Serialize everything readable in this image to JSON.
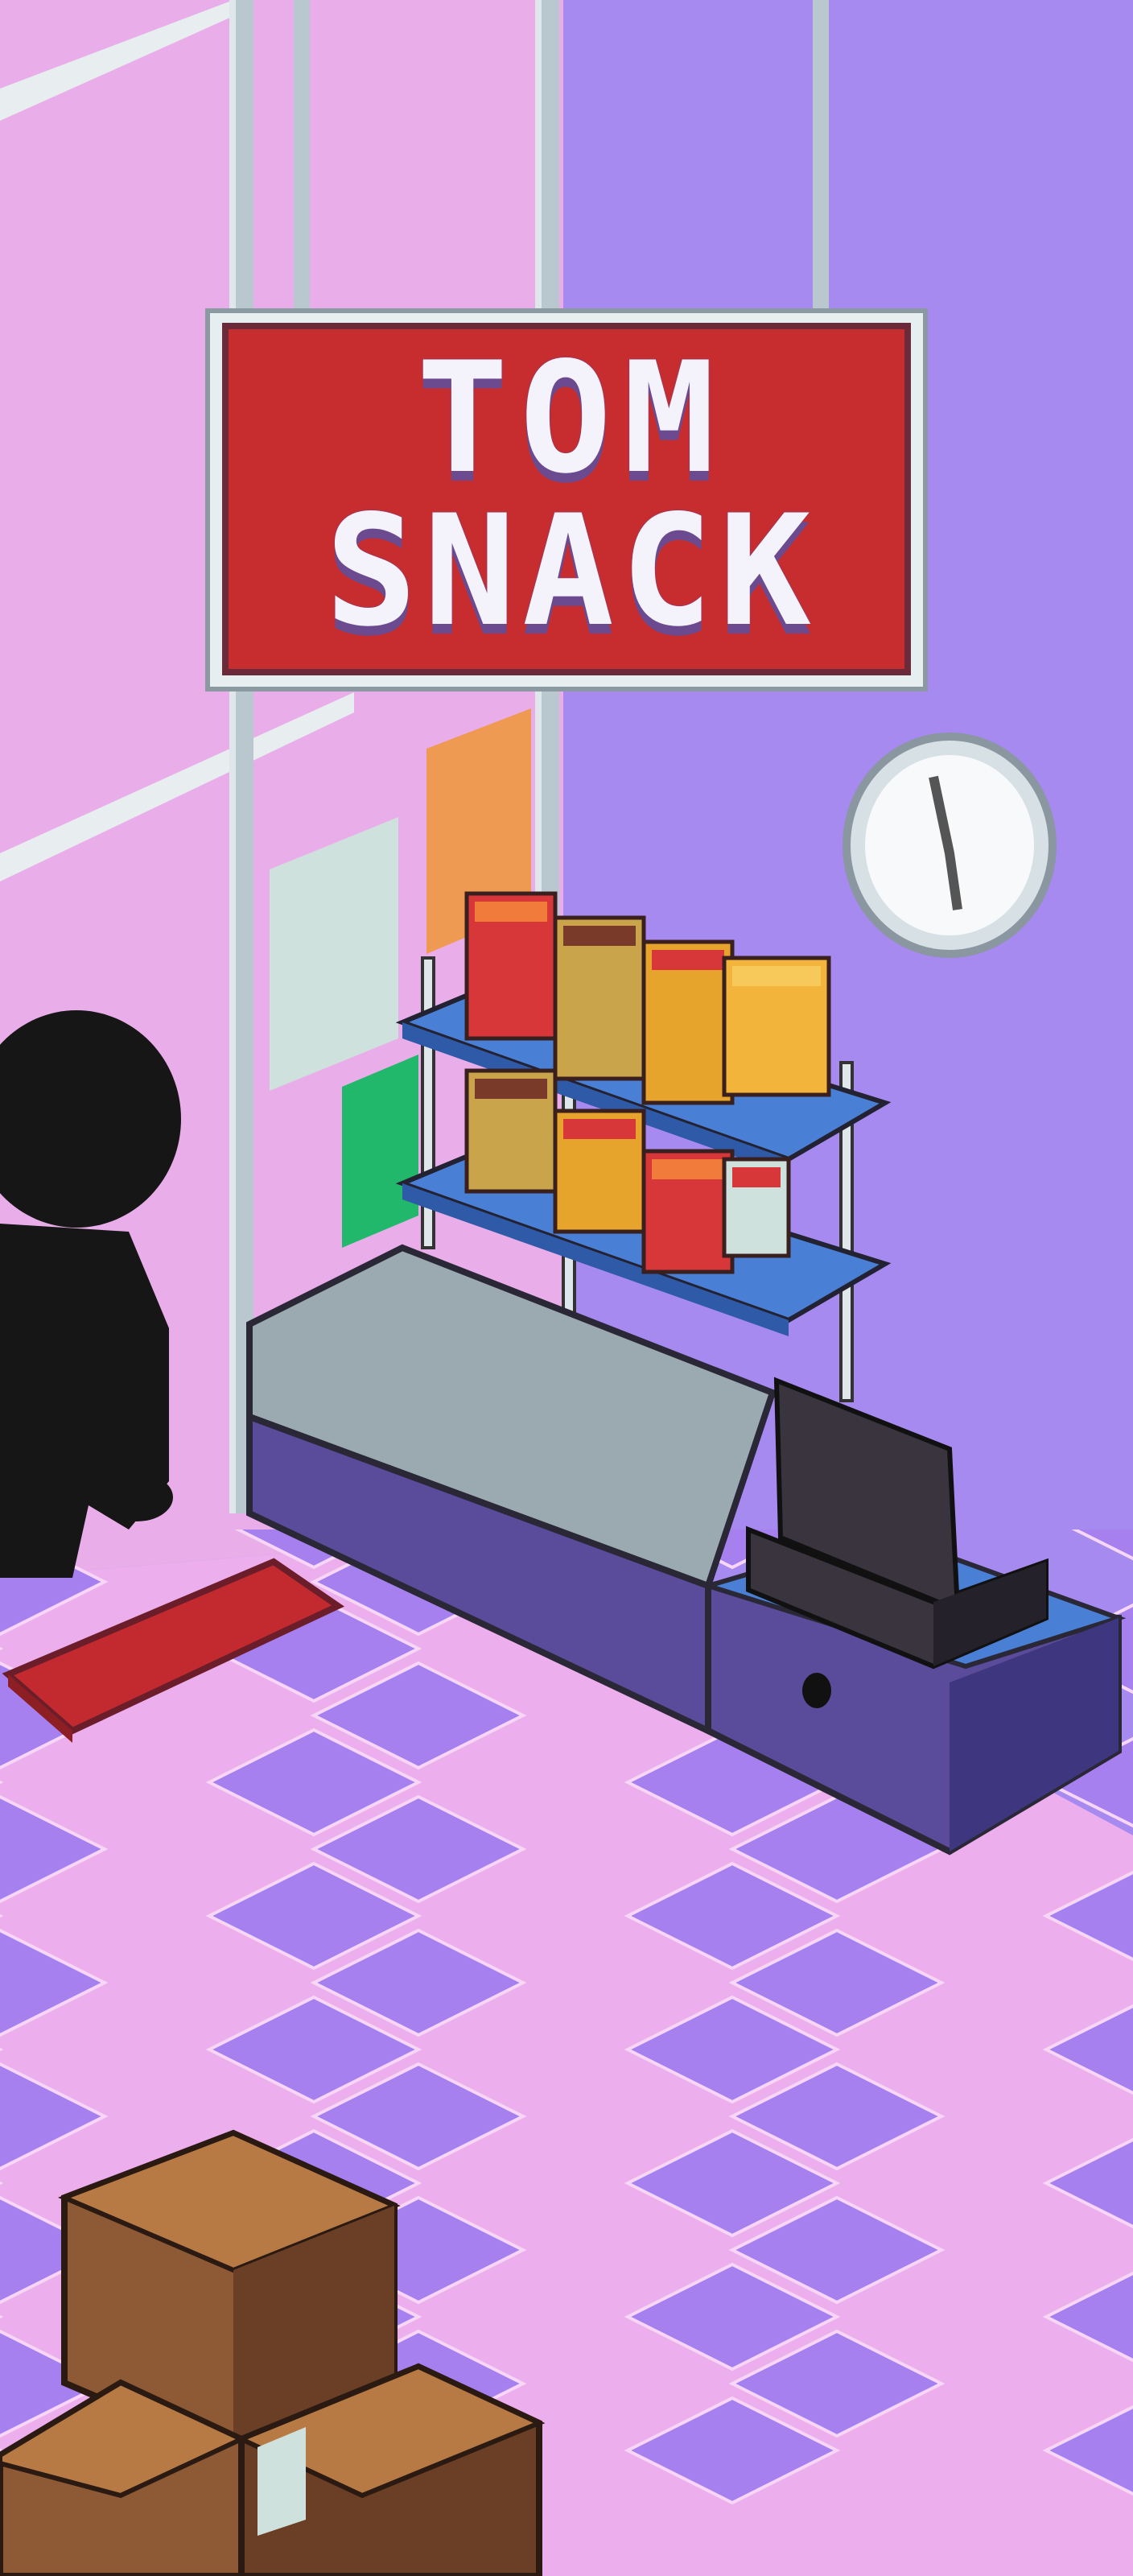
{
  "sign": {
    "line1": "TOM",
    "line2": "SNACK"
  },
  "colors": {
    "wall_left": "#e9aee9",
    "wall_right": "#a78af0",
    "floor_pink": "#ecaeec",
    "floor_purple": "#a580ee",
    "sign_red": "#c72d2f",
    "sign_frame": "#e6eef0",
    "pole": "#b9c8ce",
    "shelf_blue": "#4a7fd6",
    "counter_body": "#5a4c9a",
    "counter_top": "#9aaab0",
    "register": "#3a343e",
    "box_brown": "#8e5a35",
    "silhouette": "#161616",
    "mat_red": "#c32a30"
  },
  "icons": [
    "wall-clock-icon",
    "snack-box-icon",
    "cardboard-box-icon",
    "cash-register-icon",
    "customer-silhouette-icon"
  ]
}
